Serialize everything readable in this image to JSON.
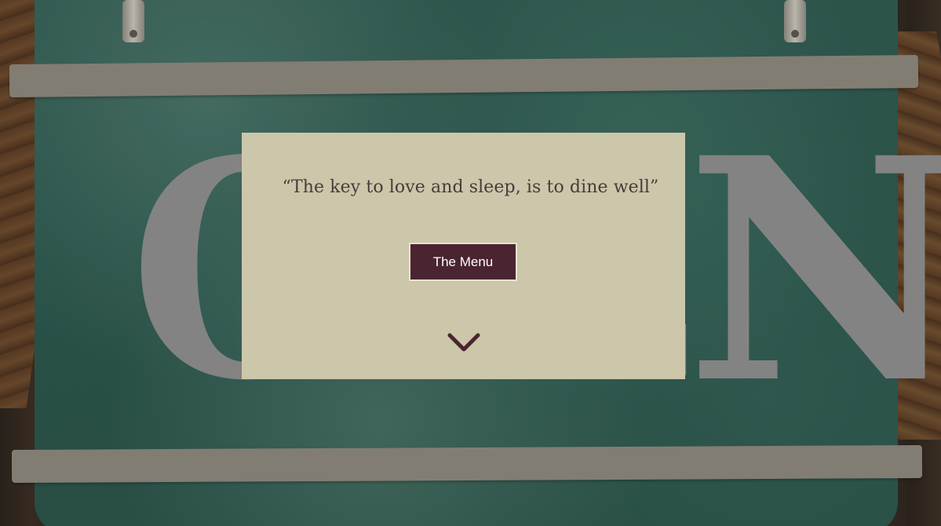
{
  "background": {
    "sign_text": "OPEN",
    "sign_color": "#2f5a50",
    "lettering_color": "#8c8c8c"
  },
  "hero": {
    "quote": "“The key to love and sleep, is to dine well”",
    "menu_button_label": "The Menu",
    "scroll_icon": "chevron-down-icon",
    "card_color": "#ccc6aa",
    "button_color": "#4a2431"
  }
}
